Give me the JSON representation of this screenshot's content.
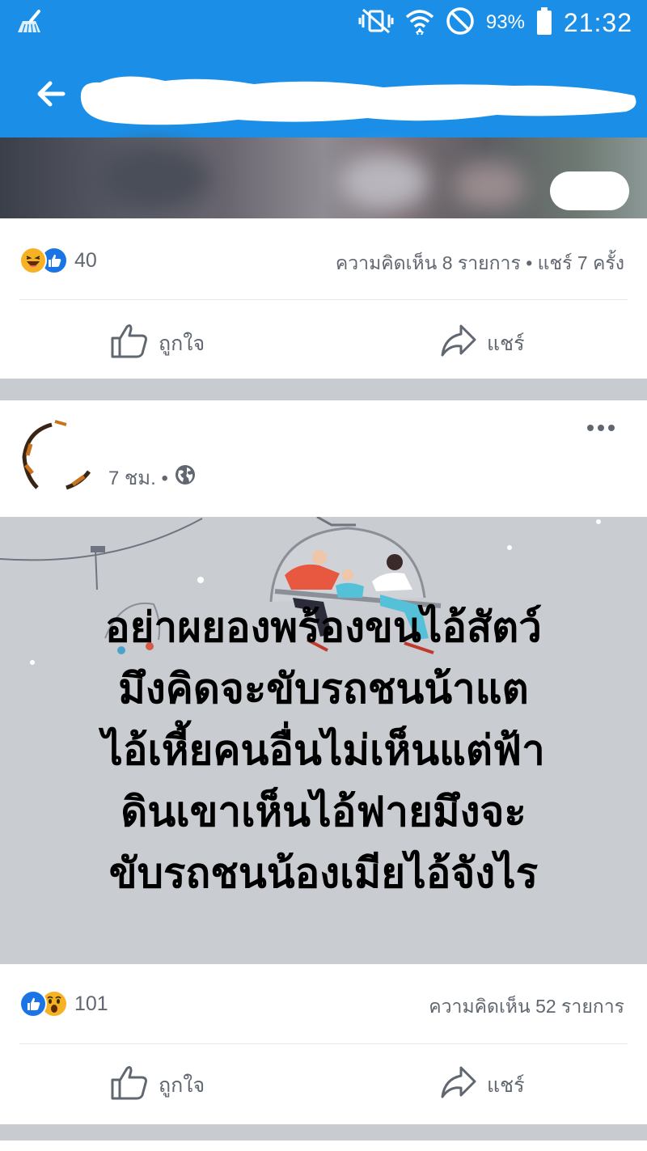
{
  "status_bar": {
    "battery": "93%",
    "time": "21:32",
    "icons": [
      "cleaner-broom-icon",
      "vibrate-mute-icon",
      "wifi-icon",
      "do-not-disturb-icon",
      "battery-icon"
    ]
  },
  "app_bar": {
    "back_icon": "arrow-left-icon",
    "title": ""
  },
  "post1": {
    "reaction_icons": [
      "haha-reaction-icon",
      "like-reaction-icon"
    ],
    "reaction_count": "40",
    "comments_shares": "ความคิดเห็น 8 รายการ • แชร์ 7 ครั้ง",
    "like_label": "ถูกใจ",
    "share_label": "แชร์"
  },
  "post2": {
    "time": "7 ชม. •",
    "privacy_icon": "globe-icon",
    "text_lines": [
      "อย่าผยองพร้องขนไอ้สัตว์",
      "มึงคิดจะขับรถชนน้าแต",
      "ไอ้เหี้ยคนอื่นไม่เห็นแต่ฟ้า",
      "ดินเขาเห็นไอ้ฟายมึงจะ",
      "ขับรถชนน้องเมียไอ้จังไร"
    ],
    "reaction_icons": [
      "like-reaction-icon",
      "wow-reaction-icon"
    ],
    "reaction_count": "101",
    "comments": "ความคิดเห็น 52 รายการ",
    "like_label": "ถูกใจ",
    "share_label": "แชร์"
  },
  "colors": {
    "brand_blue": "#1b8fe8",
    "text_gray": "#606770",
    "image_bg": "#c9ccd1"
  }
}
